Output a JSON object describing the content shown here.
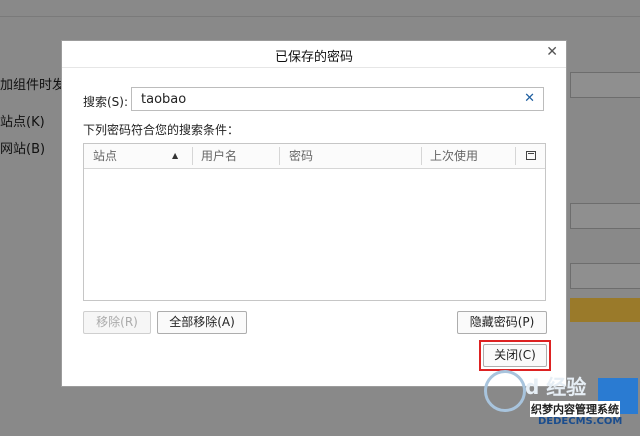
{
  "background": {
    "labels": [
      "加组件时发",
      "站点(K)",
      "网站(B)"
    ]
  },
  "dialog": {
    "title": "已保存的密码",
    "close_icon": "close-icon",
    "search": {
      "label": "搜索(S):",
      "value": "taobao",
      "clear_icon": "clear-icon"
    },
    "hint": "下列密码符合您的搜索条件：",
    "table": {
      "columns": [
        "站点",
        "用户名",
        "密码",
        "上次使用"
      ],
      "sort_column": "站点",
      "sort_direction": "ascending",
      "column_picker_icon": "column-picker-icon",
      "rows": []
    },
    "buttons": {
      "remove": "移除(R)",
      "remove_all": "全部移除(A)",
      "hide_passwords": "隐藏密码(P)",
      "close": "关闭(C)"
    },
    "highlight_color": "#dd2222"
  },
  "watermark": {
    "logo_text": "d 经验",
    "site_name": "织梦内容管理系统",
    "url": "DEDECMS.COM"
  }
}
